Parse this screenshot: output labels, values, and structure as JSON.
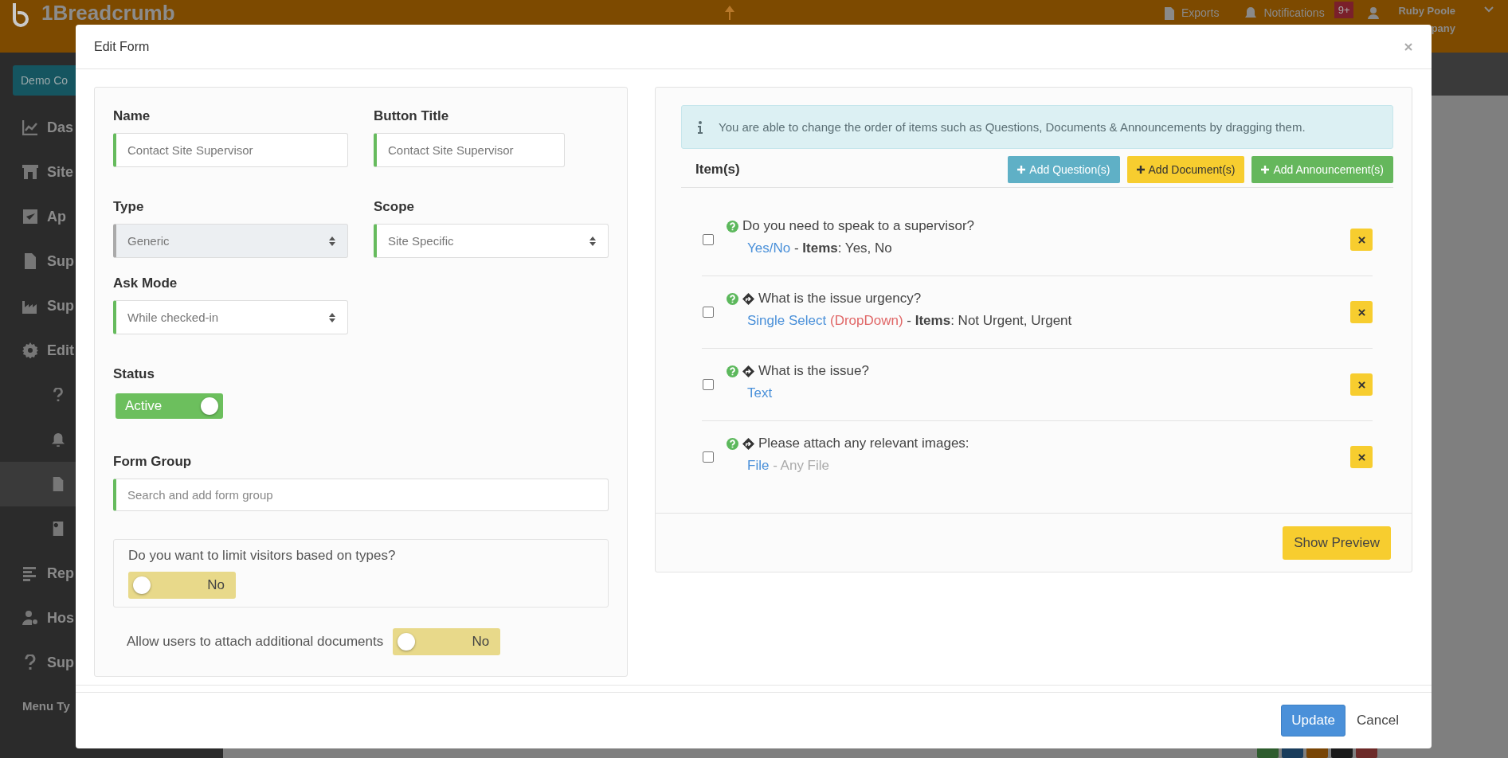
{
  "topbar": {
    "logo": "1Breadcrumb",
    "events": "Exports",
    "notification": "Notifications",
    "notification_count": "9+",
    "user_name": "Ruby Poole",
    "user_company": "pany"
  },
  "sidebar": {
    "company_button": "Demo Co",
    "items": [
      {
        "kind": "main",
        "label": "Das",
        "selected": false
      },
      {
        "kind": "main",
        "label": "Site",
        "selected": false
      },
      {
        "kind": "main",
        "label": "Ap",
        "selected": false
      },
      {
        "kind": "main",
        "label": "Sup",
        "selected": false
      },
      {
        "kind": "main",
        "label": "Sup",
        "selected": false
      },
      {
        "kind": "main",
        "label": "Edit",
        "selected": false
      },
      {
        "kind": "sub",
        "selected": false
      },
      {
        "kind": "sub",
        "selected": false
      },
      {
        "kind": "sub",
        "selected": true
      },
      {
        "kind": "sub",
        "selected": false
      },
      {
        "kind": "main",
        "label": "Rep",
        "selected": false
      },
      {
        "kind": "main",
        "label": "Hos",
        "selected": false
      },
      {
        "kind": "main",
        "label": "Sup",
        "selected": false
      }
    ],
    "menu_type": "Menu Ty"
  },
  "modal": {
    "title": "Edit Form",
    "form": {
      "name": {
        "label": "Name",
        "value": "Contact Site Supervisor"
      },
      "button_title": {
        "label": "Button Title",
        "value": "Contact Site Supervisor"
      },
      "type": {
        "label": "Type",
        "value": "Generic",
        "disabled": true
      },
      "scope": {
        "label": "Scope",
        "value": "Site Specific",
        "disabled": false
      },
      "ask_mode": {
        "label": "Ask Mode",
        "value": "While checked-in",
        "disabled": false
      },
      "status": {
        "label": "Status",
        "toggle": {
          "text": "Active",
          "on": true
        }
      },
      "form_group": {
        "label": "Form Group",
        "placeholder": "Search and add form group"
      },
      "limit_visitors": {
        "question": "Do you want to limit visitors based on types?",
        "toggle": {
          "text": "No",
          "on": false
        }
      },
      "attach_documents": {
        "label": "Allow users to attach additional documents",
        "toggle": {
          "text": "No",
          "on": false
        }
      }
    },
    "items_panel": {
      "info": "You are able to change the order of items such as Questions, Documents & Announcements by dragging them.",
      "heading": "Item(s)",
      "buttons": [
        {
          "kind": "question",
          "label": "Add Question(s)"
        },
        {
          "kind": "document",
          "label": "Add Document(s)"
        },
        {
          "kind": "announcement",
          "label": "Add Announcement(s)"
        }
      ],
      "items": [
        {
          "checked": false,
          "branching": false,
          "question": "Do you need to speak to a supervisor?",
          "type": "Yes/No",
          "detail": "- **Items**: Yes, No",
          "muted": false
        },
        {
          "checked": false,
          "branching": true,
          "question": "What is the issue urgency?",
          "type": "Single Select",
          "tag": "(DropDown)",
          "detail": "- **Items**: Not Urgent, Urgent",
          "muted": false
        },
        {
          "checked": false,
          "branching": true,
          "question": "What is the issue?",
          "type": "Text",
          "muted": false
        },
        {
          "checked": false,
          "branching": true,
          "question": "Please attach any relevant images:",
          "type": "File",
          "detail": "- Any File",
          "muted": true
        }
      ],
      "preview": "Show Preview"
    },
    "footer": {
      "update": "Update",
      "cancel": "Cancel"
    }
  }
}
